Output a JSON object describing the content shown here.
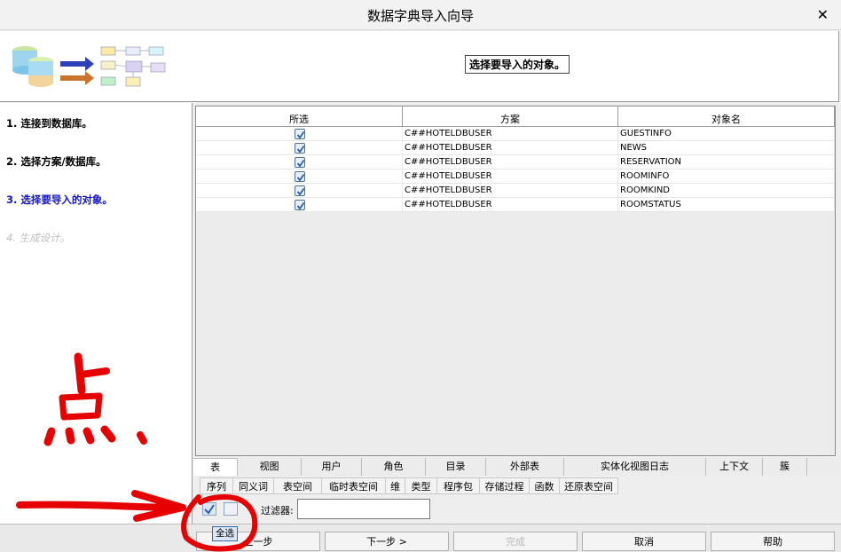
{
  "window": {
    "title": "数据字典导入向导"
  },
  "header": {
    "title": "选择要导入的对象。"
  },
  "steps": [
    {
      "label": "1. 连接到数据库。",
      "state": "done"
    },
    {
      "label": "2. 选择方案/数据库。",
      "state": "done"
    },
    {
      "label": "3. 选择要导入的对象。",
      "state": "active"
    },
    {
      "label": "4. 生成设计。",
      "state": "disabled"
    }
  ],
  "grid": {
    "columns": [
      "所选",
      "方案",
      "对象名"
    ],
    "rows": [
      {
        "selected": true,
        "schema": "C##HOTELDBUSER",
        "object": "GUESTINFO"
      },
      {
        "selected": true,
        "schema": "C##HOTELDBUSER",
        "object": "NEWS"
      },
      {
        "selected": true,
        "schema": "C##HOTELDBUSER",
        "object": "RESERVATION"
      },
      {
        "selected": true,
        "schema": "C##HOTELDBUSER",
        "object": "ROOMINFO"
      },
      {
        "selected": true,
        "schema": "C##HOTELDBUSER",
        "object": "ROOMKIND"
      },
      {
        "selected": true,
        "schema": "C##HOTELDBUSER",
        "object": "ROOMSTATUS"
      }
    ]
  },
  "tabs_row1": [
    "表",
    "视图",
    "用户",
    "角色",
    "目录",
    "外部表",
    "实体化视图日志",
    "上下文",
    "簇"
  ],
  "tabs_row2": [
    "序列",
    "同义词",
    "表空间",
    "临时表空间",
    "维",
    "类型",
    "程序包",
    "存储过程",
    "函数",
    "还原表空间"
  ],
  "filter": {
    "label": "过滤器:",
    "value": ""
  },
  "tooltip": "全选",
  "buttons": {
    "back": "上一步",
    "next": "下一步 >",
    "finish": "完成",
    "cancel": "取消",
    "help": "帮助"
  },
  "annotation": {
    "text": "点.",
    "color": "#e60000"
  },
  "colors": {
    "active_step": "#1414c8",
    "check": "#2a5db0"
  }
}
